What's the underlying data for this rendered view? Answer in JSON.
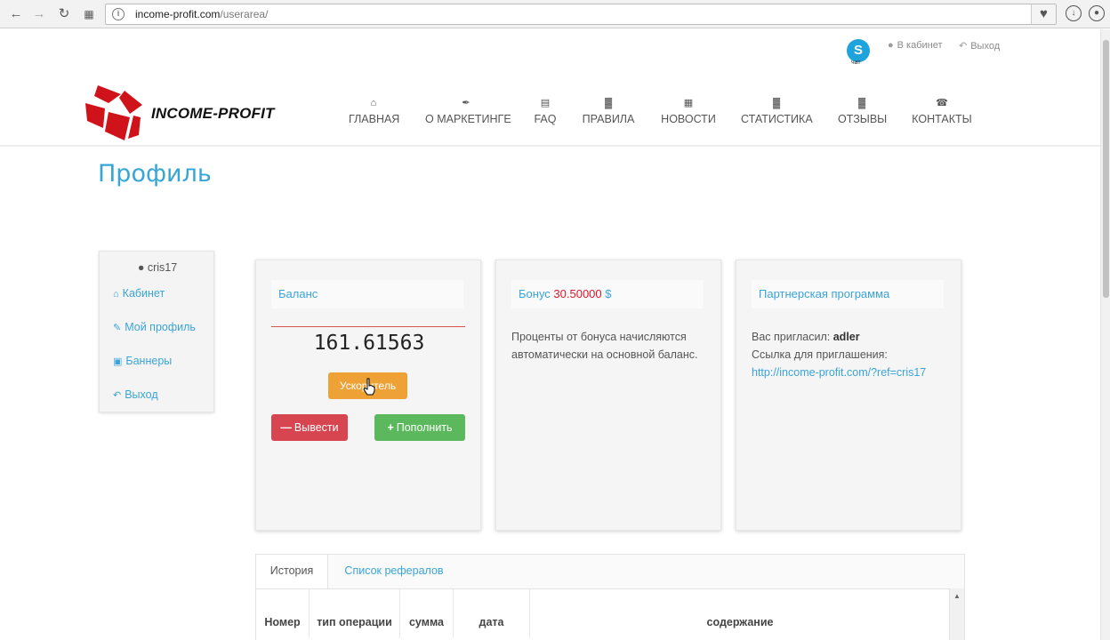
{
  "browser": {
    "url_host": "income-profit.com",
    "url_path": "/userarea/",
    "site_icon": "i"
  },
  "top_links": {
    "skype_letter": "S",
    "skype_label": "чат",
    "cabinet": "В кабинет",
    "logout": "Выход"
  },
  "brand": {
    "name": "INCOME-PROFIT"
  },
  "nav": [
    {
      "label": "ГЛАВНАЯ",
      "icon": "home-icon"
    },
    {
      "label": "О МАРКЕТИНГЕ",
      "icon": "paperclip-icon"
    },
    {
      "label": "FAQ",
      "icon": "list-icon"
    },
    {
      "label": "ПРАВИЛА",
      "icon": "bar-chart-icon"
    },
    {
      "label": "НОВОСТИ",
      "icon": "newspaper-icon"
    },
    {
      "label": "СТАТИСТИКА",
      "icon": "bar-chart-icon"
    },
    {
      "label": "ОТЗЫВЫ",
      "icon": "bar-chart-icon"
    },
    {
      "label": "КОНТАКТЫ",
      "icon": "phone-icon"
    }
  ],
  "page_title": "Профиль",
  "sidebar": {
    "username": "cris17",
    "items": [
      {
        "label": "Кабинет",
        "icon": "home-icon"
      },
      {
        "label": "Мой профиль",
        "icon": "edit-icon"
      },
      {
        "label": "Баннеры",
        "icon": "image-icon"
      },
      {
        "label": "Выход",
        "icon": "reply-icon"
      }
    ]
  },
  "balance_card": {
    "title": "Баланс",
    "value": "161.61563",
    "accelerator_label": "Ускоритель",
    "withdraw_label": "Вывести",
    "deposit_label": "Пополнить"
  },
  "bonus_card": {
    "title_prefix": "Бонус",
    "amount": "30.50000",
    "currency": "$",
    "text": "Проценты от бонуса начисляются автоматически на основной баланс."
  },
  "partner_card": {
    "title": "Партнерская программа",
    "invited_label": "Вас пригласил:",
    "inviter": "adler",
    "ref_label": "Ссылка для приглашения:",
    "ref_link": "http://income-profit.com/?ref=cris17"
  },
  "tabs": [
    {
      "label": "История",
      "active": true
    },
    {
      "label": "Список рефералов",
      "active": false
    }
  ],
  "table": {
    "headers": [
      "Номер",
      "тип операции",
      "сумма",
      "дата",
      "содержание"
    ]
  },
  "colors": {
    "accent": "#36a6d6",
    "warning": "#eea236",
    "danger": "#d64550",
    "success": "#5cb85c",
    "brand_red": "#d0121b"
  }
}
